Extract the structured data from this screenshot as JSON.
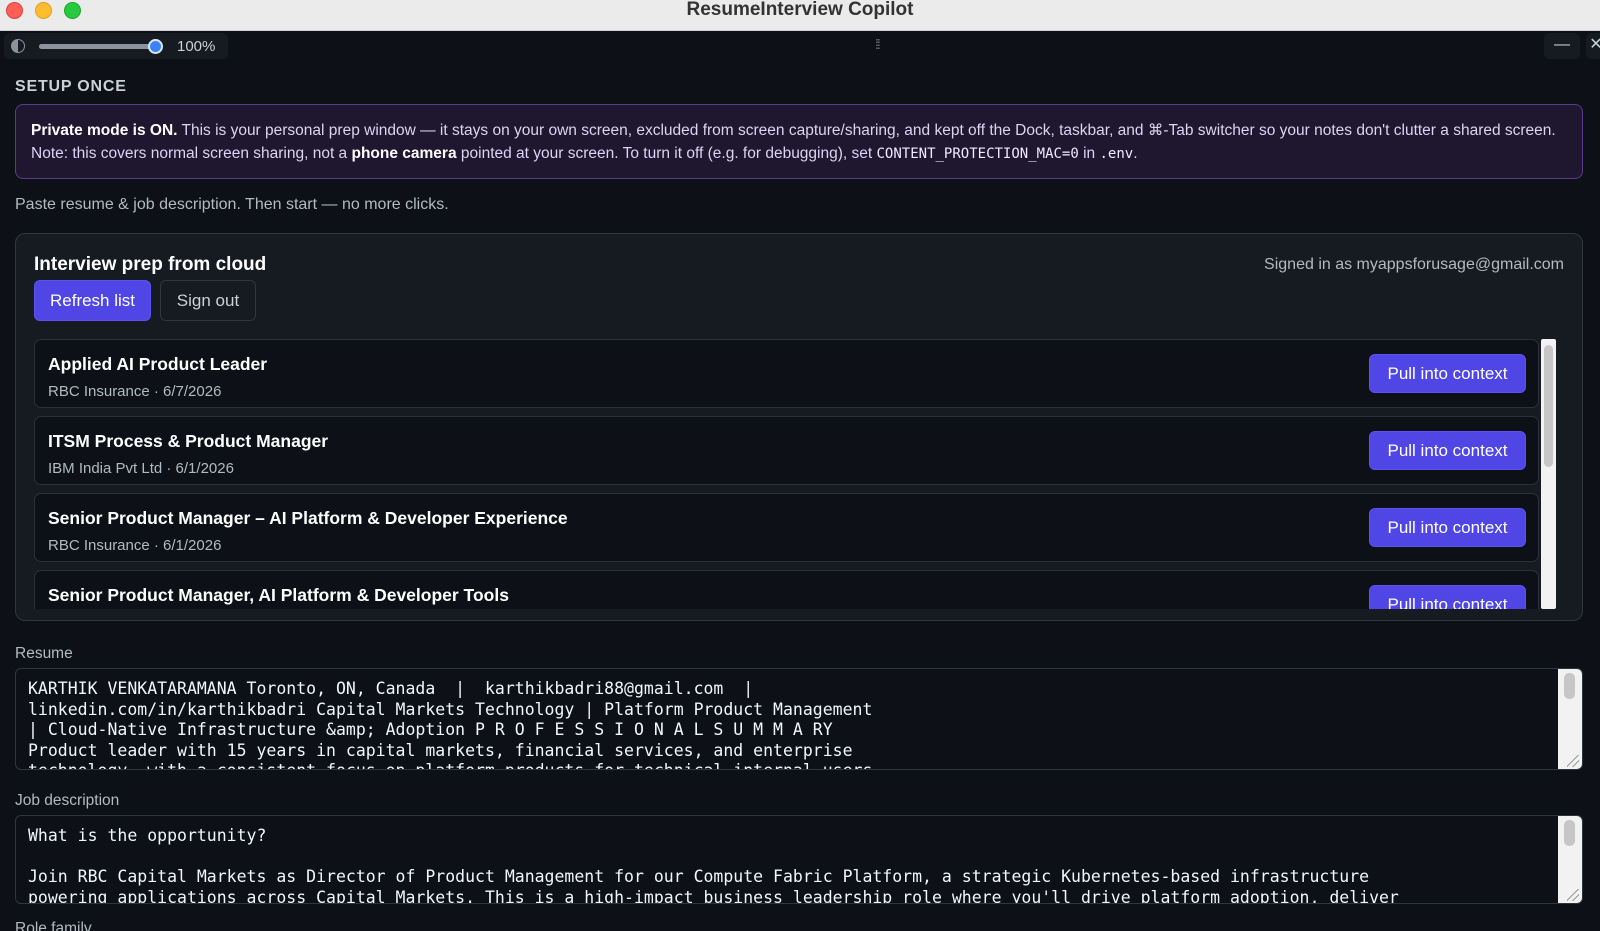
{
  "window": {
    "title": "ResumeInterview Copilot"
  },
  "toolbar": {
    "zoom": "100%",
    "opacity_value": 1.0,
    "minimize_glyph": "—",
    "close_glyph": "✕"
  },
  "setup": {
    "section_title": "SETUP ONCE",
    "notice": {
      "bold_lead": "Private mode is ON.",
      "text1": " This is your personal prep window — it stays on your own screen, excluded from screen capture/sharing, and kept off the Dock, taskbar, and ⌘-Tab switcher so your notes don't clutter a shared screen. Note: this covers normal screen sharing, not a ",
      "bold_mid": "phone camera",
      "text2": " pointed at your screen. To turn it off (e.g. for debugging), set ",
      "code1": "CONTENT_PROTECTION_MAC=0",
      "text3": " in ",
      "code2": ".env",
      "text4": "."
    },
    "hint": "Paste resume & job description. Then start — no more clicks."
  },
  "cloud_panel": {
    "title": "Interview prep from cloud",
    "signed_in": "Signed in as myappsforusage@gmail.com",
    "refresh_label": "Refresh list",
    "signout_label": "Sign out",
    "pull_label": "Pull into context",
    "jobs": [
      {
        "title": "Applied AI Product Leader",
        "meta": "RBC Insurance · 6/7/2026"
      },
      {
        "title": "ITSM Process & Product Manager",
        "meta": "IBM India Pvt Ltd · 6/1/2026"
      },
      {
        "title": "Senior Product Manager – AI Platform & Developer Experience",
        "meta": "RBC Insurance · 6/1/2026"
      },
      {
        "title": "Senior Product Manager, AI Platform & Developer Tools",
        "meta": ""
      }
    ]
  },
  "resume": {
    "label": "Resume",
    "value": "KARTHIK VENKATARAMANA Toronto, ON, Canada  |  karthikbadri88@gmail.com  |\nlinkedin.com/in/karthikbadri Capital Markets Technology | Platform Product Management\n| Cloud-Native Infrastructure &amp; Adoption P R O F E S S I O N A L S U M M A RY\nProduct leader with 15 years in capital markets, financial services, and enterprise\ntechnology, with a consistent focus on platform products for technical internal users"
  },
  "job_description": {
    "label": "Job description",
    "value": "What is the opportunity?\n\nJoin RBC Capital Markets as Director of Product Management for our Compute Fabric Platform, a strategic Kubernetes-based infrastructure\npowering applications across Capital Markets. This is a high-impact business leadership role where you'll drive platform adoption, deliver"
  },
  "next_label": "Role family"
}
